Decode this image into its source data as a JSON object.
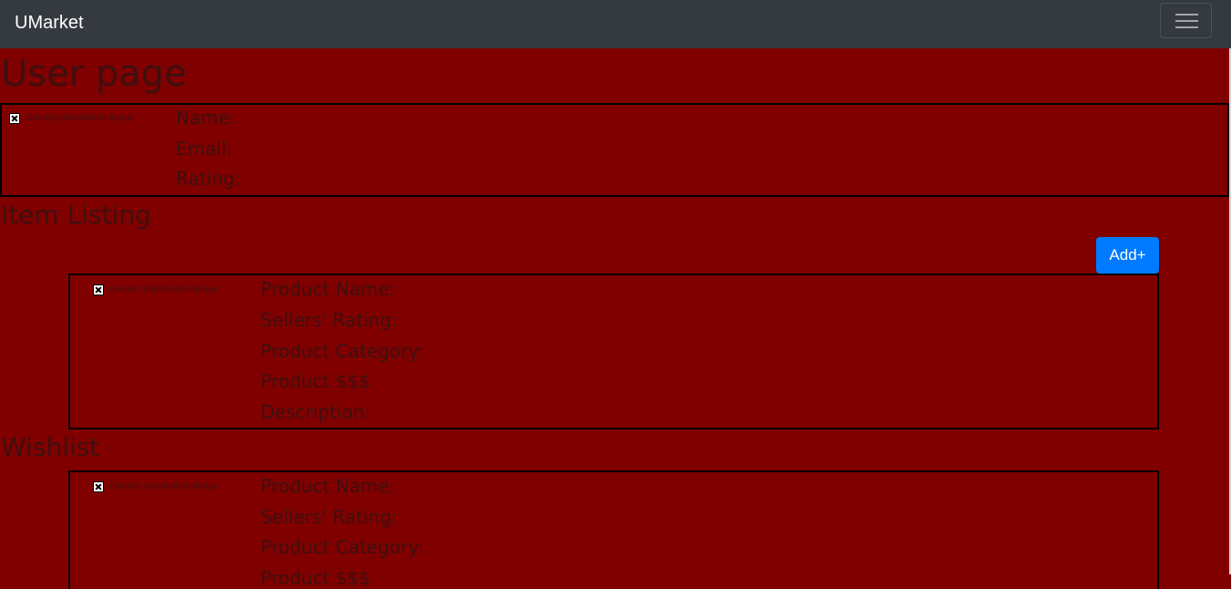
{
  "navbar": {
    "brand": "UMarket",
    "toggler_icon": "hamburger-menu-icon"
  },
  "page": {
    "title": "User page"
  },
  "profile": {
    "image_alt": "Generic placeholder image",
    "name_label": "Name:",
    "email_label": "Email:",
    "rating_label": "Rating:"
  },
  "item_listing": {
    "heading": "Item Listing",
    "add_button": "Add+",
    "card": {
      "image_alt": "Generic placeholder image",
      "product_name_label": "Product Name:",
      "sellers_rating_label": "Sellers' Rating:",
      "product_category_label": "Product Category:",
      "product_price_label": "Product $$$",
      "description_label": "Description:"
    }
  },
  "wishlist": {
    "heading": "Wishlist",
    "card": {
      "image_alt": "Generic placeholder image",
      "product_name_label": "Product Name:",
      "sellers_rating_label": "Sellers' Rating:",
      "product_category_label": "Product Category:",
      "product_price_label": "Product $$$"
    }
  },
  "colors": {
    "background": "#800000",
    "navbar": "#343a40",
    "primary_button": "#007bff"
  }
}
